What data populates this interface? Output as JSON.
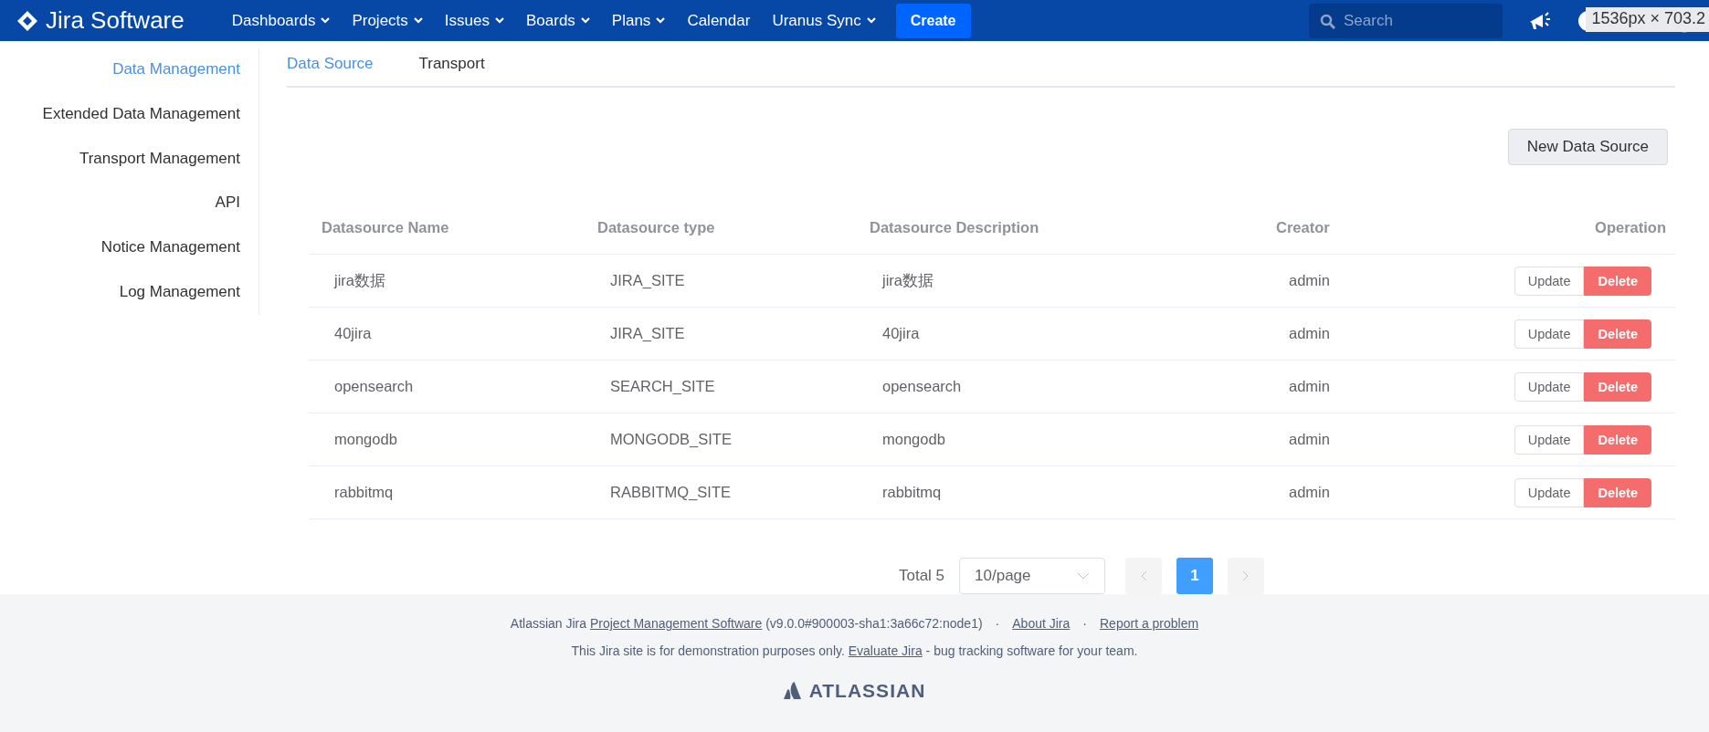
{
  "header": {
    "logo": "Jira Software",
    "nav": [
      {
        "label": "Dashboards",
        "dropdown": true
      },
      {
        "label": "Projects",
        "dropdown": true
      },
      {
        "label": "Issues",
        "dropdown": true
      },
      {
        "label": "Boards",
        "dropdown": true
      },
      {
        "label": "Plans",
        "dropdown": true
      },
      {
        "label": "Calendar",
        "dropdown": false
      },
      {
        "label": "Uranus Sync",
        "dropdown": true
      }
    ],
    "create": "Create",
    "search": {
      "placeholder": "Search"
    }
  },
  "viewport_size_label": "1536px × 703.2",
  "sidebar": {
    "items": [
      {
        "label": "Data Management",
        "selected": true
      },
      {
        "label": "Extended Data Management",
        "selected": false
      },
      {
        "label": "Transport Management",
        "selected": false
      },
      {
        "label": "API",
        "selected": false
      },
      {
        "label": "Notice Management",
        "selected": false
      },
      {
        "label": "Log Management",
        "selected": false
      }
    ]
  },
  "tabs": [
    {
      "label": "Data Source",
      "selected": true
    },
    {
      "label": "Transport",
      "selected": false
    }
  ],
  "new_button": "New Data Source",
  "table": {
    "columns": [
      "Datasource Name",
      "Datasource type",
      "Datasource Description",
      "Creator",
      "Operation"
    ],
    "rows": [
      {
        "name": "jira数据",
        "type": "JIRA_SITE",
        "description": "jira数据",
        "creator": "admin",
        "actions": [
          "Update",
          "Delete"
        ]
      },
      {
        "name": "40jira",
        "type": "JIRA_SITE",
        "description": "40jira",
        "creator": "admin",
        "actions": [
          "Update",
          "Delete"
        ]
      },
      {
        "name": "opensearch",
        "type": "SEARCH_SITE",
        "description": "opensearch",
        "creator": "admin",
        "actions": [
          "Update",
          "Delete"
        ]
      },
      {
        "name": "mongodb",
        "type": "MONGODB_SITE",
        "description": "mongodb",
        "creator": "admin",
        "actions": [
          "Update",
          "Delete"
        ]
      },
      {
        "name": "rabbitmq",
        "type": "RABBITMQ_SITE",
        "description": "rabbitmq",
        "creator": "admin",
        "actions": [
          "Update",
          "Delete"
        ]
      }
    ]
  },
  "pagination": {
    "total": "Total 5",
    "page_size": "10/page",
    "pages": [
      {
        "label": "1",
        "selected": true
      }
    ]
  },
  "footer": {
    "lines": [
      [
        {
          "kind": "text",
          "text": "Atlassian Jira "
        },
        {
          "kind": "link",
          "text": "Project Management Software"
        },
        {
          "kind": "text",
          "text": " (v9.0.0#900003-sha1:3a66c72:node1)"
        },
        {
          "kind": "sep",
          "text": "·"
        },
        {
          "kind": "link",
          "text": "About Jira"
        },
        {
          "kind": "sep",
          "text": "·"
        },
        {
          "kind": "link",
          "text": "Report a problem"
        }
      ],
      [
        {
          "kind": "text",
          "text": "This Jira site is for demonstration purposes only. "
        },
        {
          "kind": "link",
          "text": "Evaluate Jira"
        },
        {
          "kind": "text",
          "text": " - bug tracking software for your team."
        }
      ]
    ],
    "brand": "ATLASSIAN"
  }
}
